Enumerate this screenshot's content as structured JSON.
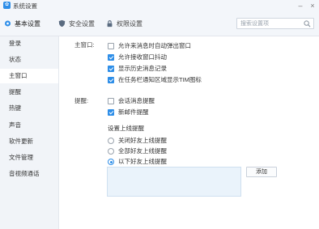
{
  "window": {
    "title": "系统设置",
    "app_icon": "app-logo-icon"
  },
  "toolbar": {
    "tabs": [
      {
        "label": "基本设置",
        "icon": "gear-icon",
        "active": true
      },
      {
        "label": "安全设置",
        "icon": "shield-icon",
        "active": false
      },
      {
        "label": "权限设置",
        "icon": "lock-icon",
        "active": false
      }
    ],
    "search": {
      "placeholder": "搜索设置项",
      "value": ""
    }
  },
  "sidebar": {
    "items": [
      {
        "label": "登录",
        "selected": false
      },
      {
        "label": "状态",
        "selected": false
      },
      {
        "label": "主窗口",
        "selected": true
      },
      {
        "label": "提醒",
        "selected": false
      },
      {
        "label": "热键",
        "selected": false
      },
      {
        "label": "声音",
        "selected": false
      },
      {
        "label": "软件更新",
        "selected": false
      },
      {
        "label": "文件管理",
        "selected": false
      },
      {
        "label": "音视频通话",
        "selected": false
      }
    ]
  },
  "main_window": {
    "section_label": "主窗口:",
    "options": [
      {
        "label": "允许来消息时自动弹出窗口",
        "checked": false
      },
      {
        "label": "允许接收窗口抖动",
        "checked": true
      },
      {
        "label": "显示历史消息记录",
        "checked": true
      },
      {
        "label": "在任务栏通知区域显示TIM图标",
        "checked": true
      }
    ]
  },
  "reminder": {
    "section_label": "提醒:",
    "options": [
      {
        "label": "会话消息提醒",
        "checked": false
      },
      {
        "label": "新邮件提醒",
        "checked": true
      }
    ],
    "online_heading": "设置上线提醒",
    "online_options": [
      {
        "label": "关闭好友上线提醒",
        "selected": false
      },
      {
        "label": "全部好友上线提醒",
        "selected": false
      },
      {
        "label": "以下好友上线提醒",
        "selected": true
      }
    ],
    "add_label": "添加"
  },
  "colors": {
    "accent": "#2e8ee8",
    "sidebar_bg": "#f1f4f8",
    "toolbar_bg": "#f3f6fa",
    "list_bg": "#eaf3fb"
  }
}
